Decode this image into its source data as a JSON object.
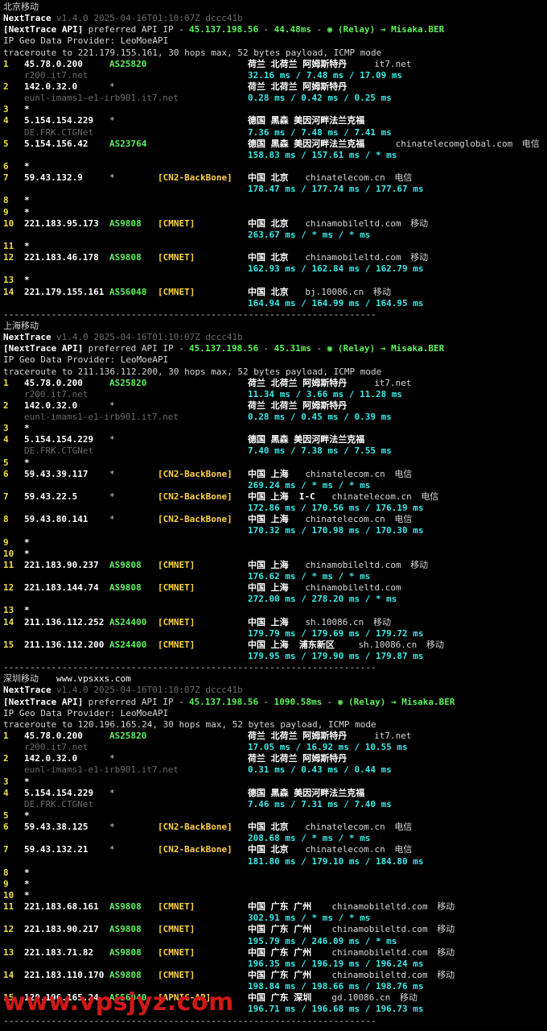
{
  "sections": [
    {
      "title": "北京移动",
      "site": "",
      "tool": "NextTrace",
      "version": "v1.4.0 2025-04-16T01:10:07Z dccc41b",
      "api_line": {
        "prefix": "[NextTrace API]",
        "text": " preferred API IP - ",
        "ip": "45.137.198.56",
        "dash": " - ",
        "latency": "44.48ms",
        "tail": " - ",
        "relay": "◉ (Relay) → Misaka.BER"
      },
      "geo_provider": "IP Geo Data Provider: LeoMoeAPI",
      "traceroute": "traceroute to 221.179.155.161, 30 hops max, 52 bytes payload, ICMP mode",
      "hops": [
        {
          "n": "1",
          "ip": "45.78.0.200",
          "asn": "AS25820",
          "tag": "",
          "geo": "荷兰 北荷兰 阿姆斯特丹",
          "host": "it7.net",
          "isp": "",
          "rdns": "r200.it7.net",
          "rtt": "32.16 ms / 7.48 ms / 17.09 ms"
        },
        {
          "n": "2",
          "ip": "142.0.32.0",
          "asn": "*",
          "tag": "",
          "geo": "荷兰 北荷兰 阿姆斯特丹",
          "host": "",
          "isp": "",
          "rdns": "eunl-imams1-e1-irb901.it7.net",
          "rtt": "0.28 ms / 0.42 ms / 0.25 ms"
        },
        {
          "n": "3",
          "star": true
        },
        {
          "n": "4",
          "ip": "5.154.154.229",
          "asn": "*",
          "tag": "",
          "geo": "德国 黑森 美因河畔法兰克福",
          "host": "",
          "isp": "",
          "rdns": "DE.FRK.CTGNet",
          "rtt": "7.36 ms / 7.48 ms / 7.41 ms"
        },
        {
          "n": "5",
          "ip": "5.154.156.42",
          "asn": "AS23764",
          "tag": "",
          "geo": "德国 黑森 美因河畔法兰克福",
          "host": "chinatelecomglobal.com",
          "isp": "电信",
          "rdns": "",
          "rtt": "158.83 ms / 157.61 ms / * ms"
        },
        {
          "n": "6",
          "star": true
        },
        {
          "n": "7",
          "ip": "59.43.132.9",
          "asn": "*",
          "tag": "[CN2-BackBone]",
          "geo": "中国 北京",
          "host": "chinatelecom.cn",
          "isp": "电信",
          "rdns": "",
          "rtt": "178.47 ms / 177.74 ms / 177.67 ms"
        },
        {
          "n": "8",
          "star": true
        },
        {
          "n": "9",
          "star": true
        },
        {
          "n": "10",
          "ip": "221.183.95.173",
          "asn": "AS9808",
          "tag": "[CMNET]",
          "geo": "中国 北京",
          "host": "chinamobileltd.com",
          "isp": "移动",
          "rdns": "",
          "rtt": "263.67 ms / * ms / * ms"
        },
        {
          "n": "11",
          "star": true
        },
        {
          "n": "12",
          "ip": "221.183.46.178",
          "asn": "AS9808",
          "tag": "[CMNET]",
          "geo": "中国 北京",
          "host": "chinamobileltd.com",
          "isp": "移动",
          "rdns": "",
          "rtt": "162.93 ms / 162.84 ms / 162.79 ms"
        },
        {
          "n": "13",
          "star": true
        },
        {
          "n": "14",
          "ip": "221.179.155.161",
          "asn": "AS56048",
          "tag": "[CMNET]",
          "geo": "中国 北京",
          "host": "bj.10086.cn",
          "isp": "移动",
          "rdns": "",
          "rtt": "164.94 ms / 164.99 ms / 164.95 ms"
        }
      ]
    },
    {
      "title": "上海移动",
      "site": "",
      "tool": "NextTrace",
      "version": "v1.4.0 2025-04-16T01:10:07Z dccc41b",
      "api_line": {
        "prefix": "[NextTrace API]",
        "text": " preferred API IP - ",
        "ip": "45.137.198.56",
        "dash": " - ",
        "latency": "45.31ms",
        "tail": " - ",
        "relay": "◉ (Relay) → Misaka.BER"
      },
      "geo_provider": "IP Geo Data Provider: LeoMoeAPI",
      "traceroute": "traceroute to 211.136.112.200, 30 hops max, 52 bytes payload, ICMP mode",
      "hops": [
        {
          "n": "1",
          "ip": "45.78.0.200",
          "asn": "AS25820",
          "tag": "",
          "geo": "荷兰 北荷兰 阿姆斯特丹",
          "host": "it7.net",
          "isp": "",
          "rdns": "r200.it7.net",
          "rtt": "11.34 ms / 3.66 ms / 11.28 ms"
        },
        {
          "n": "2",
          "ip": "142.0.32.0",
          "asn": "*",
          "tag": "",
          "geo": "荷兰 北荷兰 阿姆斯特丹",
          "host": "",
          "isp": "",
          "rdns": "eunl-imams1-e1-irb901.it7.net",
          "rtt": "0.28 ms / 0.45 ms / 0.39 ms"
        },
        {
          "n": "3",
          "star": true
        },
        {
          "n": "4",
          "ip": "5.154.154.229",
          "asn": "*",
          "tag": "",
          "geo": "德国 黑森 美因河畔法兰克福",
          "host": "",
          "isp": "",
          "rdns": "DE.FRK.CTGNet",
          "rtt": "7.40 ms / 7.38 ms / 7.55 ms"
        },
        {
          "n": "5",
          "star": true
        },
        {
          "n": "6",
          "ip": "59.43.39.117",
          "asn": "*",
          "tag": "[CN2-BackBone]",
          "geo": "中国 上海",
          "host": "chinatelecom.cn",
          "isp": "电信",
          "rdns": "",
          "rtt": "269.24 ms / * ms / * ms"
        },
        {
          "n": "7",
          "ip": "59.43.22.5",
          "asn": "*",
          "tag": "[CN2-BackBone]",
          "geo": "中国 上海  I-C",
          "host": "chinatelecom.cn",
          "isp": "电信",
          "rdns": "",
          "rtt": "172.86 ms / 170.56 ms / 176.19 ms"
        },
        {
          "n": "8",
          "ip": "59.43.80.141",
          "asn": "*",
          "tag": "[CN2-BackBone]",
          "geo": "中国 上海",
          "host": "chinatelecom.cn",
          "isp": "电信",
          "rdns": "",
          "rtt": "170.32 ms / 170.98 ms / 170.30 ms"
        },
        {
          "n": "9",
          "star": true
        },
        {
          "n": "10",
          "star": true
        },
        {
          "n": "11",
          "ip": "221.183.90.237",
          "asn": "AS9808",
          "tag": "[CMNET]",
          "geo": "中国 上海",
          "host": "chinamobileltd.com",
          "isp": "移动",
          "rdns": "",
          "rtt": "176.62 ms / * ms / * ms"
        },
        {
          "n": "12",
          "ip": "221.183.144.74",
          "asn": "AS9808",
          "tag": "[CMNET]",
          "geo": "中国 上海",
          "host": "chinamobileltd.com",
          "isp": "",
          "rdns": "",
          "rtt": "272.00 ms / 278.20 ms / * ms"
        },
        {
          "n": "13",
          "star": true
        },
        {
          "n": "14",
          "ip": "211.136.112.252",
          "asn": "AS24400",
          "tag": "[CMNET]",
          "geo": "中国 上海",
          "host": "sh.10086.cn",
          "isp": "移动",
          "rdns": "",
          "rtt": "179.79 ms / 179.69 ms / 179.72 ms"
        },
        {
          "n": "15",
          "ip": "211.136.112.200",
          "asn": "AS24400",
          "tag": "[CMNET]",
          "geo": "中国 上海  浦东新区",
          "host": "sh.10086.cn",
          "isp": "移动",
          "rdns": "",
          "rtt": "179.95 ms / 179.90 ms / 179.87 ms"
        }
      ]
    },
    {
      "title": "深圳移动",
      "site": "www.vpsxxs.com",
      "tool": "NextTrace",
      "version": "v1.4.0 2025-04-16T01:10:07Z dccc41b",
      "api_line": {
        "prefix": "[NextTrace API]",
        "text": " preferred API IP - ",
        "ip": "45.137.198.56",
        "dash": " - ",
        "latency": "1090.58ms",
        "tail": " - ",
        "relay": "◉ (Relay) → Misaka.BER"
      },
      "geo_provider": "IP Geo Data Provider: LeoMoeAPI",
      "traceroute": "traceroute to 120.196.165.24, 30 hops max, 52 bytes payload, ICMP mode",
      "hops": [
        {
          "n": "1",
          "ip": "45.78.0.200",
          "asn": "AS25820",
          "tag": "",
          "geo": "荷兰 北荷兰 阿姆斯特丹",
          "host": "it7.net",
          "isp": "",
          "rdns": "r200.it7.net",
          "rtt": "17.05 ms / 16.92 ms / 10.55 ms"
        },
        {
          "n": "2",
          "ip": "142.0.32.0",
          "asn": "*",
          "tag": "",
          "geo": "荷兰 北荷兰 阿姆斯特丹",
          "host": "",
          "isp": "",
          "rdns": "eunl-imams1-e1-irb901.it7.net",
          "rtt": "0.31 ms / 0.43 ms / 0.44 ms"
        },
        {
          "n": "3",
          "star": true
        },
        {
          "n": "4",
          "ip": "5.154.154.229",
          "asn": "*",
          "tag": "",
          "geo": "德国 黑森 美因河畔法兰克福",
          "host": "",
          "isp": "",
          "rdns": "DE.FRK.CTGNet",
          "rtt": "7.46 ms / 7.31 ms / 7.40 ms"
        },
        {
          "n": "5",
          "star": true
        },
        {
          "n": "6",
          "ip": "59.43.38.125",
          "asn": "*",
          "tag": "[CN2-BackBone]",
          "geo": "中国 北京",
          "host": "chinatelecom.cn",
          "isp": "电信",
          "rdns": "",
          "rtt": "208.68 ms / * ms / * ms"
        },
        {
          "n": "7",
          "ip": "59.43.132.21",
          "asn": "*",
          "tag": "[CN2-BackBone]",
          "geo": "中国 北京",
          "host": "chinatelecom.cn",
          "isp": "电信",
          "rdns": "",
          "rtt": "181.80 ms / 179.10 ms / 184.80 ms"
        },
        {
          "n": "8",
          "star": true
        },
        {
          "n": "9",
          "star": true
        },
        {
          "n": "10",
          "star": true
        },
        {
          "n": "11",
          "ip": "221.183.68.161",
          "asn": "AS9808",
          "tag": "[CMNET]",
          "geo": "中国 广东 广州",
          "host": "chinamobileltd.com",
          "isp": "移动",
          "rdns": "",
          "rtt": "302.91 ms / * ms / * ms"
        },
        {
          "n": "12",
          "ip": "221.183.90.217",
          "asn": "AS9808",
          "tag": "[CMNET]",
          "geo": "中国 广东 广州",
          "host": "chinamobileltd.com",
          "isp": "移动",
          "rdns": "",
          "rtt": "195.79 ms / 246.09 ms / * ms"
        },
        {
          "n": "13",
          "ip": "221.183.71.82",
          "asn": "AS9808",
          "tag": "[CMNET]",
          "geo": "中国 广东 广州",
          "host": "chinamobileltd.com",
          "isp": "移动",
          "rdns": "",
          "rtt": "196.35 ms / 196.19 ms / 196.24 ms"
        },
        {
          "n": "14",
          "ip": "221.183.110.170",
          "asn": "AS9808",
          "tag": "[CMNET]",
          "geo": "中国 广东 广州",
          "host": "chinamobileltd.com",
          "isp": "移动",
          "rdns": "",
          "rtt": "198.84 ms / 198.66 ms / 198.76 ms"
        },
        {
          "n": "15",
          "ip": "120.196.165.24",
          "asn": "AS56040",
          "tag": "[APNIC-AP]",
          "geo": "中国 广东 深圳",
          "host": "gd.10086.cn",
          "isp": "移动",
          "rdns": "",
          "rtt": "196.71 ms / 196.68 ms / 196.73 ms"
        }
      ]
    }
  ],
  "separator": "----------------------------------------------------------------------",
  "watermark": "www.vpsjyz.com",
  "colors": {
    "background": "#000000",
    "hop": "#f0e040",
    "asn": "#5ef05e",
    "rtt": "#3de8e8",
    "tag": "#ffd23c",
    "watermark": "#d01818"
  }
}
